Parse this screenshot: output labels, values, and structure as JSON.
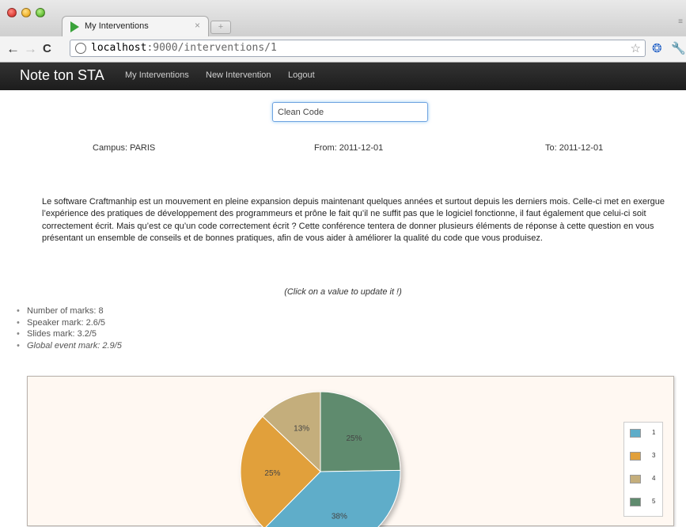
{
  "browser": {
    "tab_title": "My Interventions",
    "tab_close": "×",
    "new_tab": "+",
    "url_host": "localhost",
    "url_rest": ":9000/interventions/1",
    "back_icon": "←",
    "forward_icon": "→",
    "reload_icon": "C",
    "star_icon": "☆"
  },
  "navbar": {
    "brand": "Note ton STA",
    "links": [
      "My Interventions",
      "New Intervention",
      "Logout"
    ]
  },
  "intervention": {
    "title": "Clean Code",
    "campus": "Campus: PARIS",
    "from": "From: 2011-12-01",
    "to": "To: 2011-12-01",
    "description": "Le software Craftmanhip est un mouvement en pleine expansion depuis maintenant quelques années et surtout depuis les derniers mois. Celle-ci met en exergue l’expérience des pratiques de développement des programmeurs et prône le fait qu’il ne suffit pas que le logiciel fonctionne, il faut également que celui-ci soit correctement écrit.  Mais qu’est ce qu’un code correctement écrit ?  Cette conférence tentera de donner plusieurs éléments de réponse à cette question en vous présentant un ensemble de conseils et de bonnes pratiques, afin de vous aider à améliorer la qualité du code que vous produisez.",
    "hint": "(Click on a value to update it !)"
  },
  "marks": [
    "Number of marks: 8",
    "Speaker mark: 2.6/5",
    "Slides mark: 3.2/5",
    "Global event mark: 2.9/5"
  ],
  "colors": {
    "slice_1": "#5eadc9",
    "slice_3": "#e1a03b",
    "slice_4": "#c4ae7c",
    "slice_5": "#5f8b6e"
  },
  "chart_data": {
    "type": "pie",
    "slices": [
      {
        "label": "5",
        "value": 25,
        "text": "25%",
        "color": "#5f8b6e"
      },
      {
        "label": "1",
        "value": 38,
        "text": "38%",
        "color": "#5eadc9"
      },
      {
        "label": "3",
        "value": 25,
        "text": "25%",
        "color": "#e1a03b"
      },
      {
        "label": "4",
        "value": 13,
        "text": "13%",
        "color": "#c4ae7c"
      }
    ],
    "legend": [
      "1",
      "3",
      "4",
      "5"
    ],
    "legend_placement": "right"
  }
}
